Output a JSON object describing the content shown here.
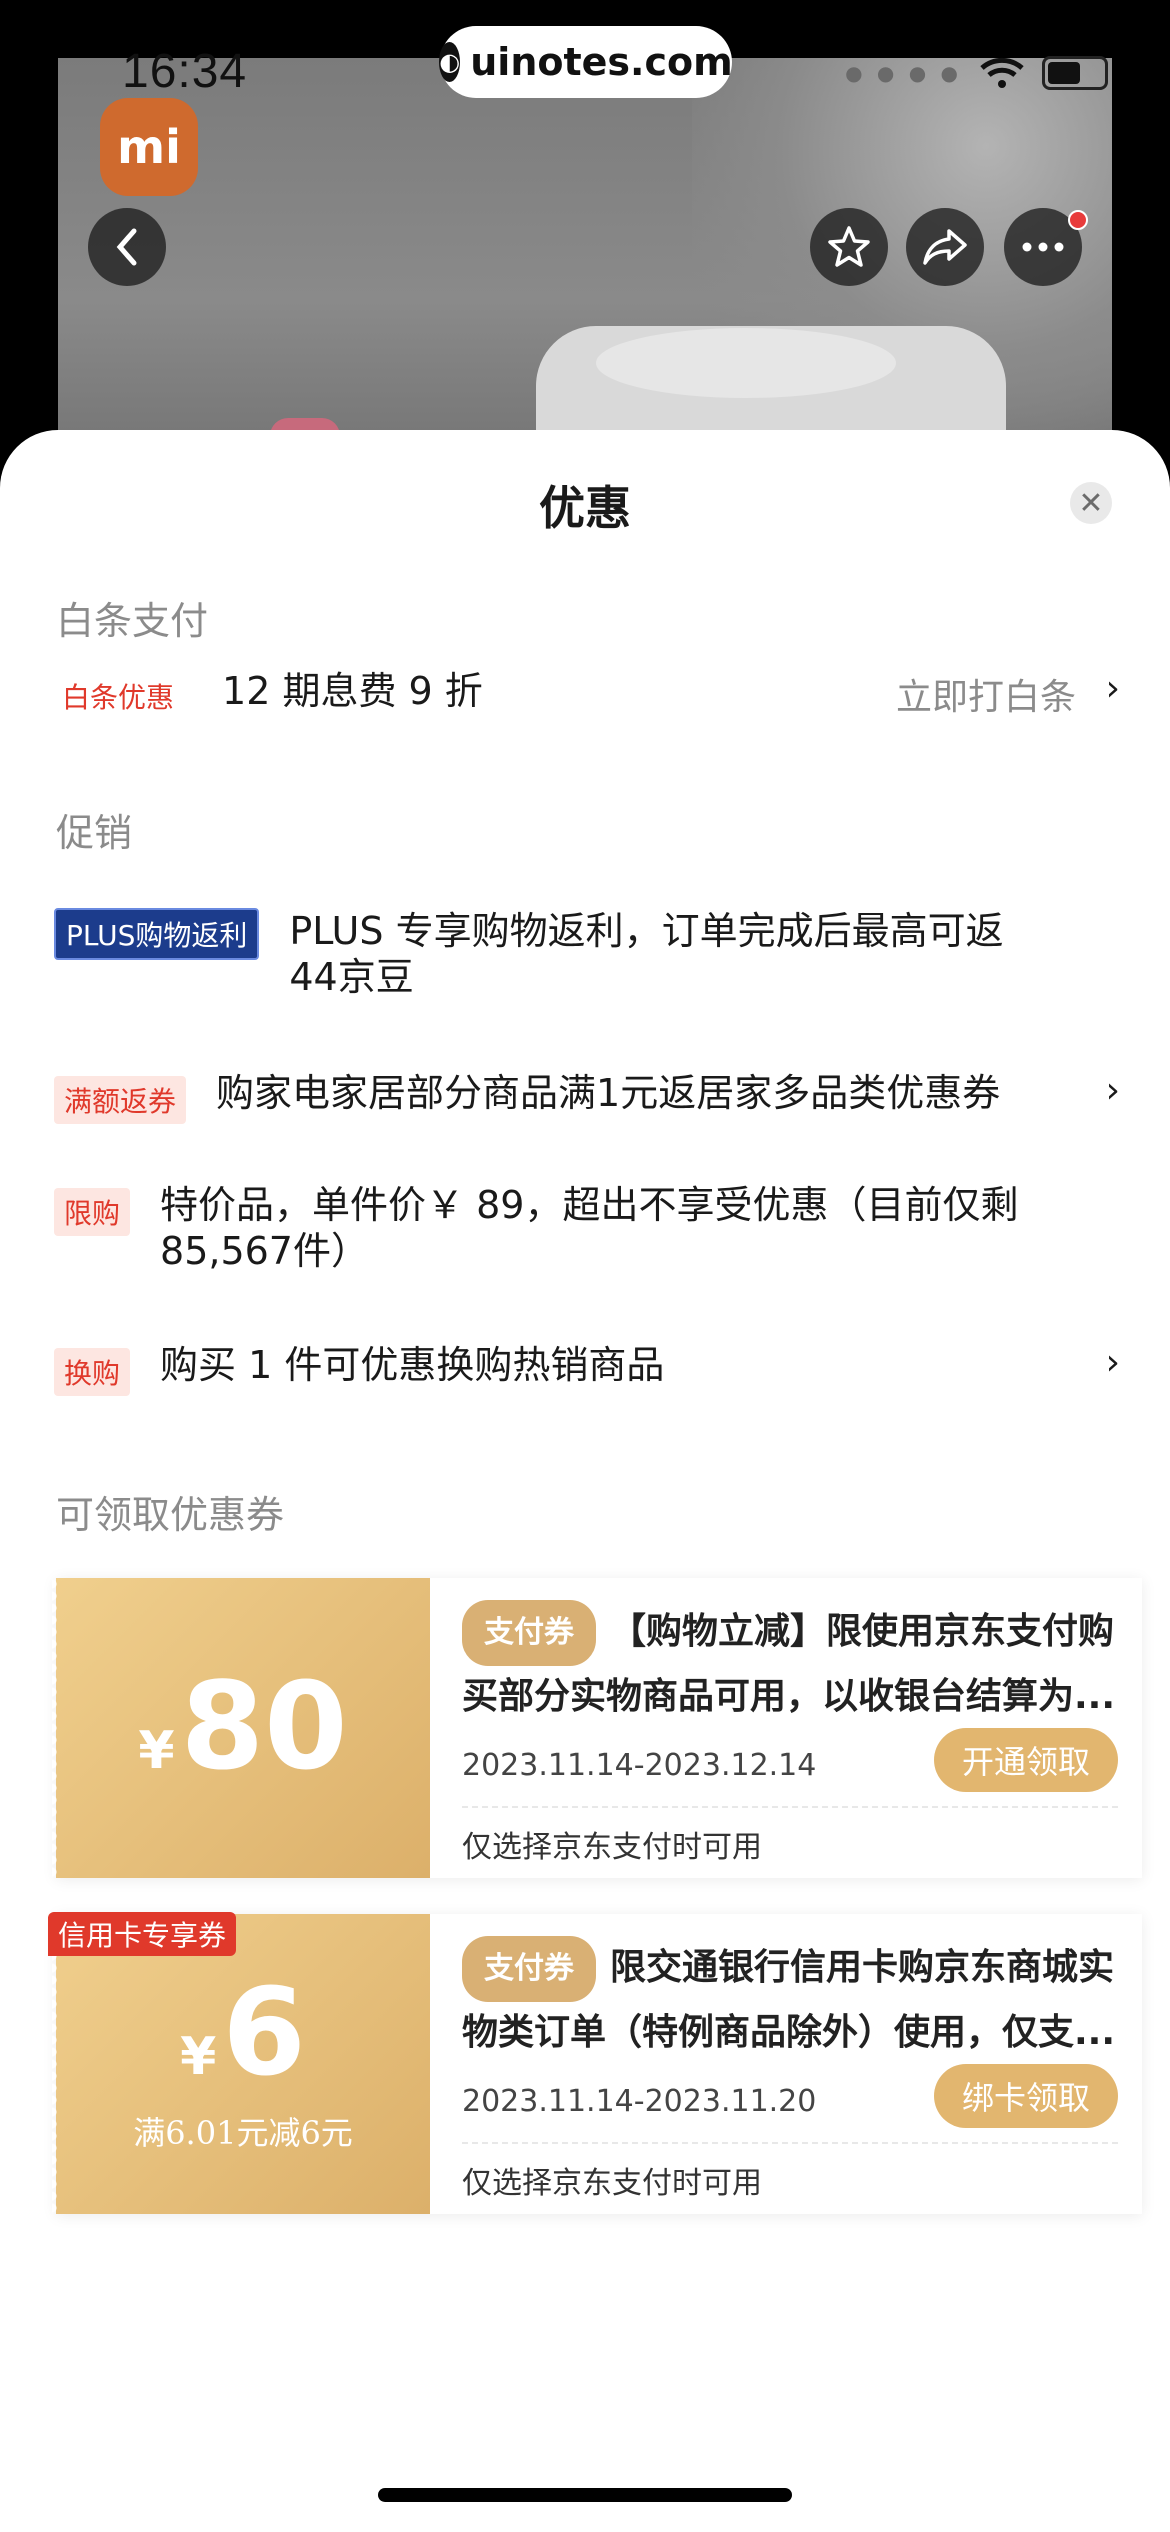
{
  "status": {
    "time": "16:34"
  },
  "watermark": {
    "text": "uinotes.com"
  },
  "product_nav": {
    "brand_logo": "mi"
  },
  "sheet": {
    "title": "优惠"
  },
  "baitiao": {
    "section_title": "白条支付",
    "tag": "白条优惠",
    "text": "12 期息费 9 折",
    "action": "立即打白条"
  },
  "promo": {
    "section_title": "促销",
    "items": [
      {
        "tag": "PLUS购物返利",
        "text": "PLUS 专享购物返利，订单完成后最高可返44京豆"
      },
      {
        "tag": "满额返券",
        "text": "购家电家居部分商品满1元返居家多品类优惠券"
      },
      {
        "tag": "限购",
        "text": "特价品，单件价￥ 89，超出不享受优惠（目前仅剩85,567件）"
      },
      {
        "tag": "换购",
        "text": "购买 1 件可优惠换购热销商品"
      }
    ]
  },
  "coupons": {
    "section_title": "可领取优惠券",
    "currency": "¥",
    "items": [
      {
        "amount": "80",
        "type": "支付券",
        "desc": "【购物立减】限使用京东支付购买部分实物商品可用，以收银台结算为...",
        "date": "2023.11.14-2023.12.14",
        "button": "开通领取",
        "note": "仅选择京东支付时可用"
      },
      {
        "ribbon": "信用卡专享券",
        "amount": "6",
        "condition": "满6.01元减6元",
        "type": "支付券",
        "desc": "限交通银行信用卡购京东商城实物类订单（特例商品除外）使用，仅支...",
        "date": "2023.11.14-2023.11.20",
        "button": "绑卡领取",
        "note": "仅选择京东支付时可用"
      }
    ]
  }
}
